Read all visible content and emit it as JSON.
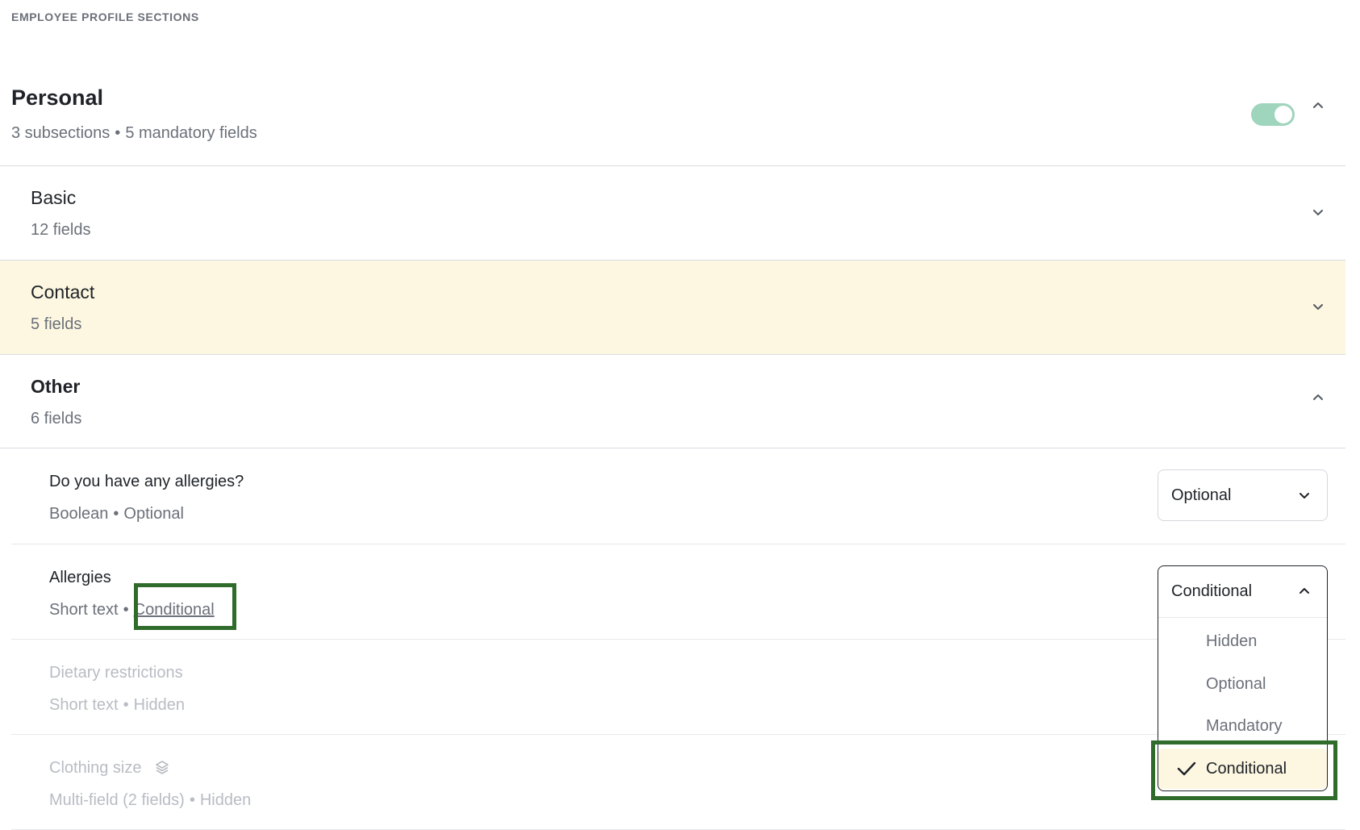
{
  "page": {
    "section_heading": "EMPLOYEE PROFILE SECTIONS"
  },
  "personal": {
    "title": "Personal",
    "subsections_count": "3 subsections",
    "mandatory_count": "5 mandatory fields",
    "separator": "•",
    "enabled": true,
    "toggle_color": "#9fd4bd"
  },
  "subsections": [
    {
      "name": "Basic",
      "count": "12 fields",
      "expanded": false
    },
    {
      "name": "Contact",
      "count": "5 fields",
      "expanded": false,
      "highlight_color": "#fdf7e1"
    },
    {
      "name": "Other",
      "count": "6 fields",
      "expanded": true
    }
  ],
  "fields": [
    {
      "name": "Do you have any allergies?",
      "type": "Boolean",
      "status": "Optional",
      "select_value": "Optional"
    },
    {
      "name": "Allergies",
      "type": "Short text",
      "status": "Conditional",
      "select_value": "Conditional"
    },
    {
      "name": "Dietary restrictions",
      "type": "Short text",
      "status": "Hidden"
    },
    {
      "name": "Clothing size",
      "type": "Multi-field (2 fields)",
      "status": "Hidden",
      "icon": "layers-icon"
    }
  ],
  "dropdown": {
    "current": "Conditional",
    "options": [
      "Hidden",
      "Optional",
      "Mandatory",
      "Conditional"
    ],
    "selected_index": 3
  },
  "annotation_color": "#2f6b2a"
}
